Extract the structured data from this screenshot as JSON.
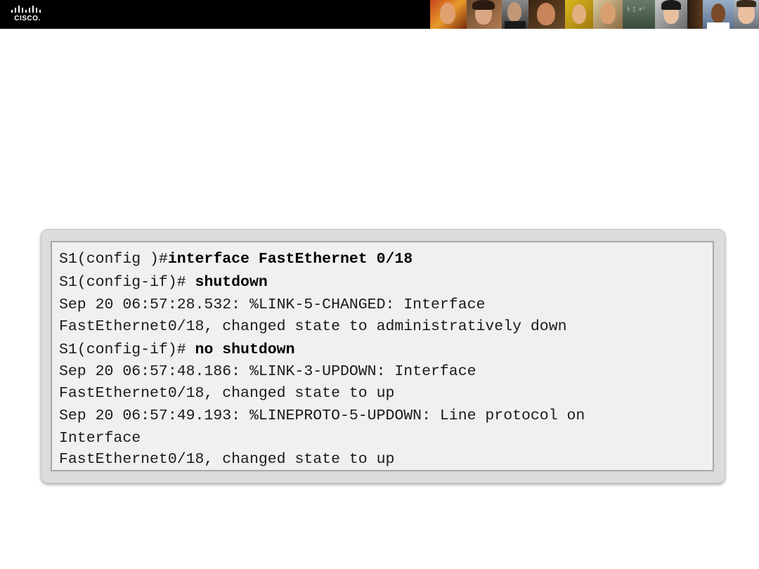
{
  "header": {
    "logo_text": "CISCO.",
    "logo_icon": "cisco-bridge-logo-icon",
    "colors": {
      "bar": "#000000",
      "logo": "#ffffff"
    }
  },
  "terminal": {
    "lines": [
      {
        "prompt": "S1(config )#",
        "command": "interface FastEthernet 0/18",
        "output": ""
      },
      {
        "prompt": "S1(config-if)# ",
        "command": "shutdown",
        "output": ""
      },
      {
        "prompt": "",
        "command": "",
        "output": "Sep 20 06:57:28.532: %LINK-5-CHANGED: Interface"
      },
      {
        "prompt": "",
        "command": "",
        "output": "FastEthernet0/18, changed state to administratively down"
      },
      {
        "prompt": "S1(config-if)# ",
        "command": "no shutdown",
        "output": ""
      },
      {
        "prompt": "",
        "command": "",
        "output": "Sep 20 06:57:48.186: %LINK-3-UPDOWN: Interface"
      },
      {
        "prompt": "",
        "command": "",
        "output": "FastEthernet0/18, changed state to up"
      },
      {
        "prompt": "",
        "command": "",
        "output": "Sep 20 06:57:49.193: %LINEPROTO-5-UPDOWN: Line protocol on"
      },
      {
        "prompt": "",
        "command": "",
        "output": "Interface"
      },
      {
        "prompt": "",
        "command": "",
        "output": "FastEthernet0/18, changed state to up"
      }
    ]
  }
}
